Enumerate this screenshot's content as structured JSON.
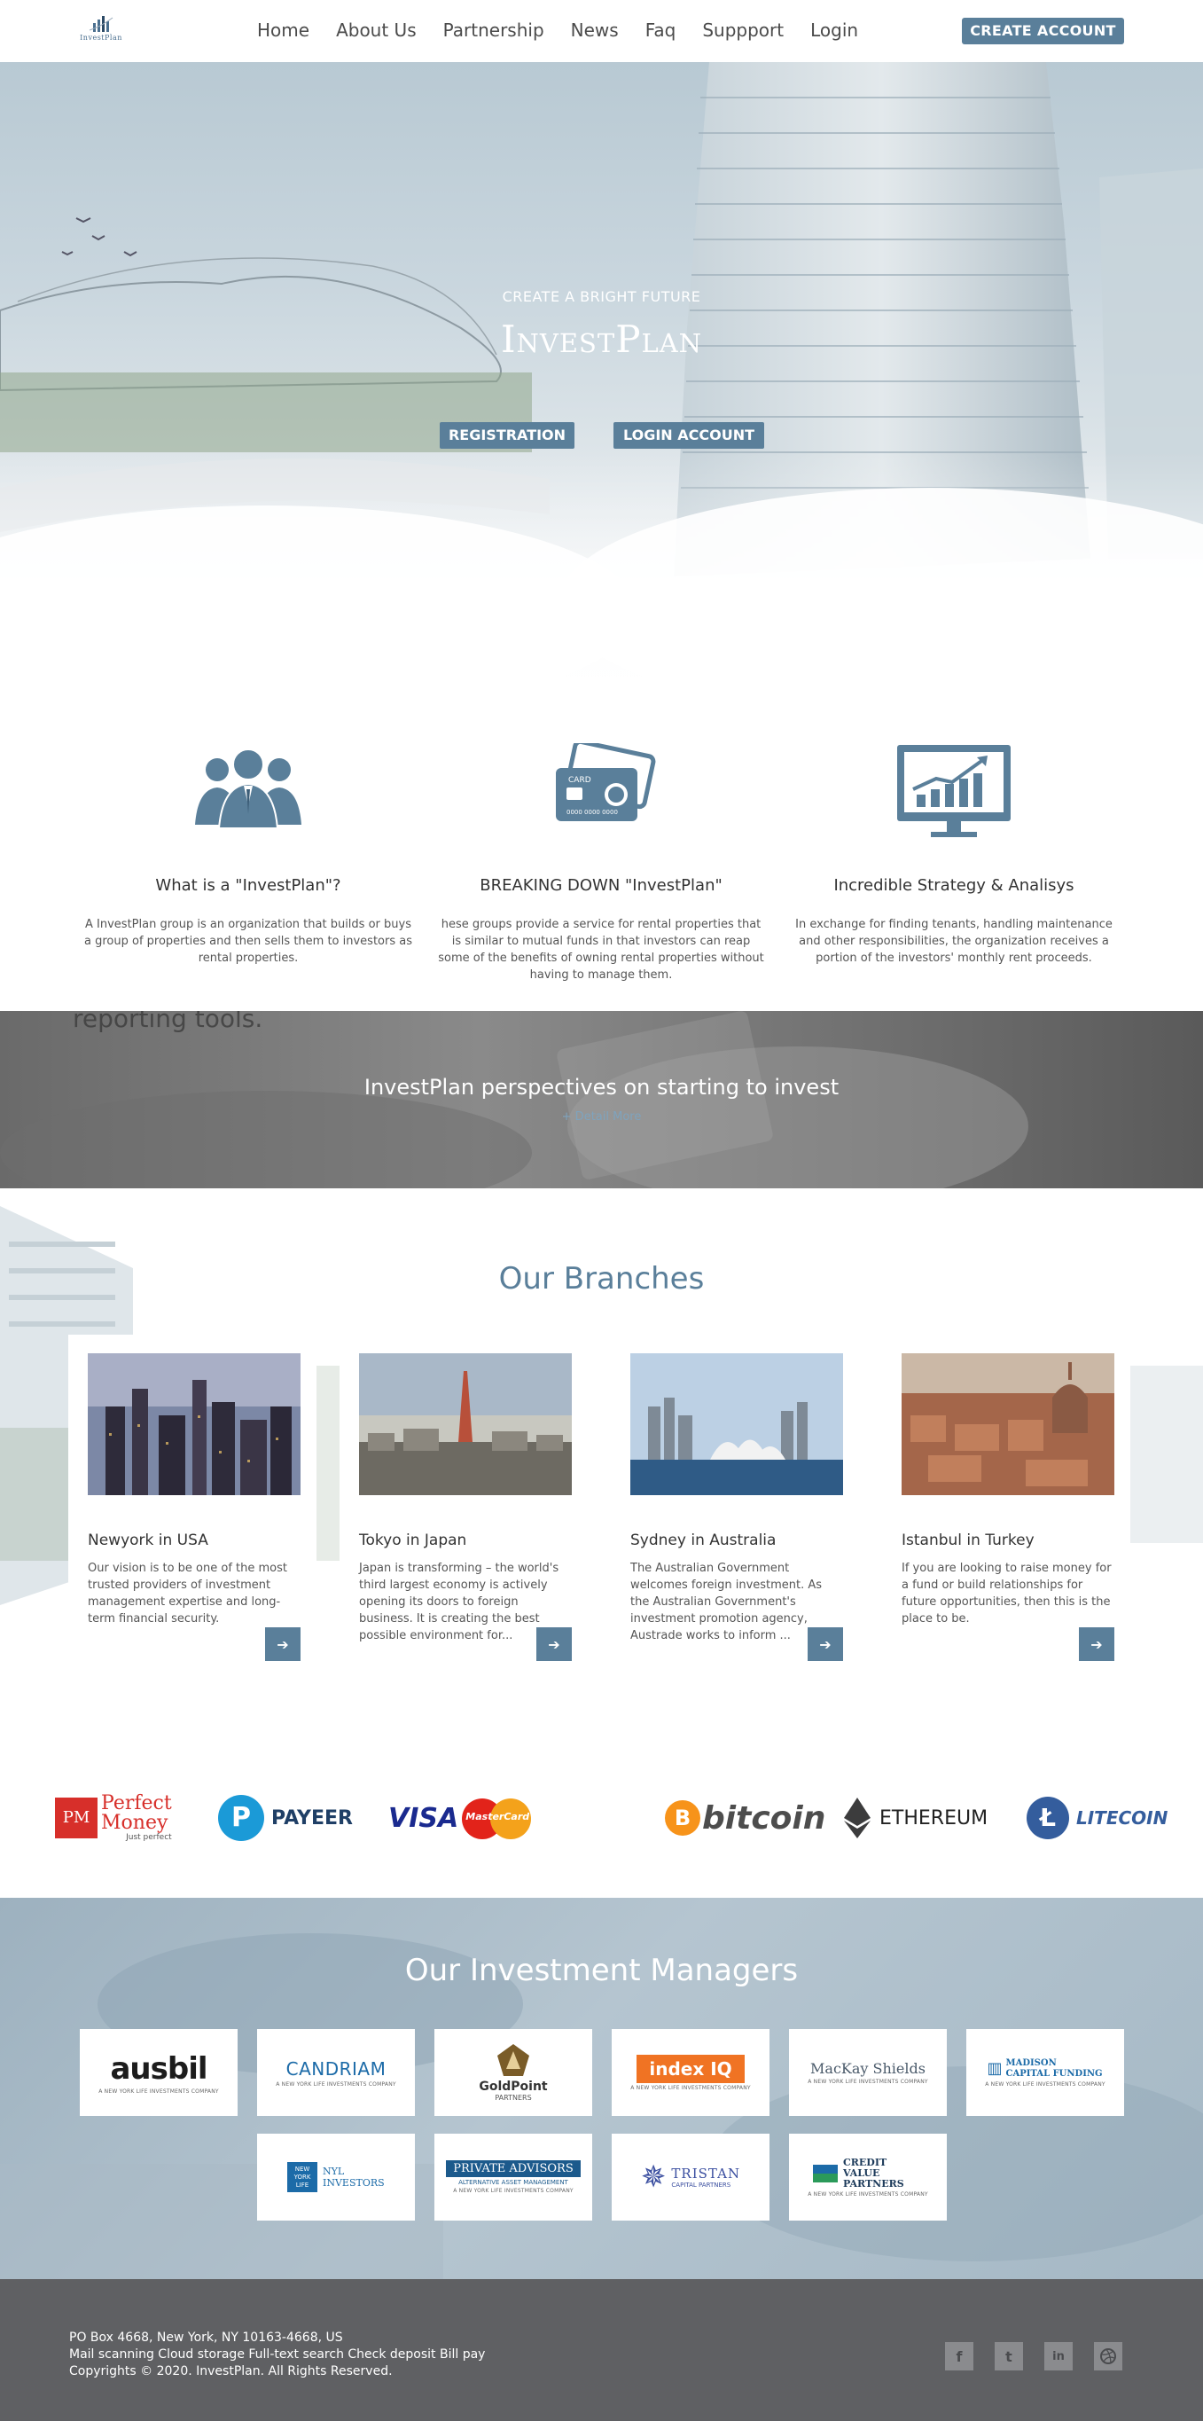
{
  "header": {
    "logo_text": "InvestPlan",
    "nav": [
      "Home",
      "About Us",
      "Partnership",
      "News",
      "Faq",
      "Suppport",
      "Login"
    ],
    "create_account": "CREATE ACCOUNT"
  },
  "hero": {
    "subtitle": "CREATE A BRIGHT FUTURE",
    "title": "InvestPlan",
    "registration": "REGISTRATION",
    "login_account": "LOGIN ACCOUNT"
  },
  "features": [
    {
      "icon": "people-icon",
      "title": "What is a \"InvestPlan\"?",
      "text": "A InvestPlan group is an organization that builds or buys a group of properties and then sells them to investors as rental properties."
    },
    {
      "icon": "credit-card-icon",
      "title": "BREAKING DOWN \"InvestPlan\"",
      "text": "hese groups provide a service for rental properties that is similar to mutual funds in that investors can reap some of the benefits of owning rental properties without having to manage them."
    },
    {
      "icon": "monitor-chart-icon",
      "title": "Incredible Strategy & Analisys",
      "text": "In exchange for finding tenants, handling maintenance and other responsibilities, the organization receives a portion of the investors' monthly rent proceeds."
    }
  ],
  "perspectives": {
    "ghost": "reporting tools.",
    "title": "InvestPlan perspectives on starting to invest",
    "more": "+ Detail More"
  },
  "branches": {
    "title": "Our Branches",
    "items": [
      {
        "title": "Newyork in USA",
        "text": "Our vision is to be one of the most trusted providers of investment management expertise and long-term financial security."
      },
      {
        "title": "Tokyo in Japan",
        "text": "Japan is transforming – the world's third largest economy is actively opening its doors to foreign business. It is creating the best possible environment for..."
      },
      {
        "title": "Sydney in Australia",
        "text": "The Australian Government welcomes foreign investment. As the Australian Government's investment promotion agency, Austrade works to inform ..."
      },
      {
        "title": "Istanbul in Turkey",
        "text": "If you are looking to raise money for a fund or build relationships for future opportunities, then this is the place to be."
      }
    ]
  },
  "payments": {
    "pm_badge": "PM",
    "pm_name1": "Perfect",
    "pm_name2": "Money",
    "pm_tag": "Just perfect",
    "payeer": "PAYEER",
    "visa": "VISA",
    "mastercard": "MasterCard",
    "bitcoin": "bitcoin",
    "ethereum": "ETHEREUM",
    "litecoin": "LITECOIN"
  },
  "managers": {
    "title": "Our Investment Managers",
    "sub": "A NEW YORK LIFE INVESTMENTS COMPANY",
    "items": [
      "ausbil",
      "CANDRIAM",
      "GoldPoint",
      "index IQ",
      "MacKay Shields",
      "MADISON CAPITAL FUNDING",
      "NYL INVESTORS",
      "PRIVATE ADVISORS",
      "TRISTAN",
      "CREDIT VALUE PARTNERS"
    ],
    "goldpoint_sub": "PARTNERS",
    "private_sub": "ALTERNATIVE ASSET MANAGEMENT",
    "tristan_sub": "CAPITAL PARTNERS"
  },
  "footer": {
    "address": "PO Box 4668, New York, NY 10163-4668, US",
    "services": "Mail scanning Cloud storage Full-text search Check deposit Bill pay",
    "copyright": "Copyrights © 2020. InvestPlan. All Rights Reserved.",
    "social": [
      "f",
      "t",
      "in",
      "dribbble"
    ]
  },
  "colors": {
    "accent": "#5a7f9a",
    "footer": "#5f6063"
  }
}
